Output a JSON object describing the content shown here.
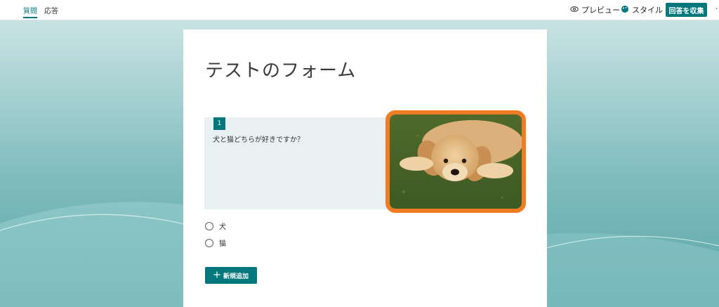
{
  "topbar": {
    "tabs": [
      {
        "label": "質問",
        "active": true
      },
      {
        "label": "応答",
        "active": false
      }
    ],
    "preview_label": "プレビュー",
    "style_label": "スタイル",
    "collect_label": "回答を収集"
  },
  "form": {
    "title": "テストのフォーム",
    "question": {
      "number": "1",
      "text": "犬と猫どちらが好きですか？",
      "options": [
        "犬",
        "猫"
      ]
    },
    "add_new_label": "新規追加"
  },
  "colors": {
    "accent": "#03787c",
    "highlight": "#f07c24",
    "question_bg": "#e8f0f2"
  },
  "icons": {
    "preview": "eye-icon",
    "style": "palette-icon",
    "add": "plus-icon",
    "more": "more-icon"
  }
}
